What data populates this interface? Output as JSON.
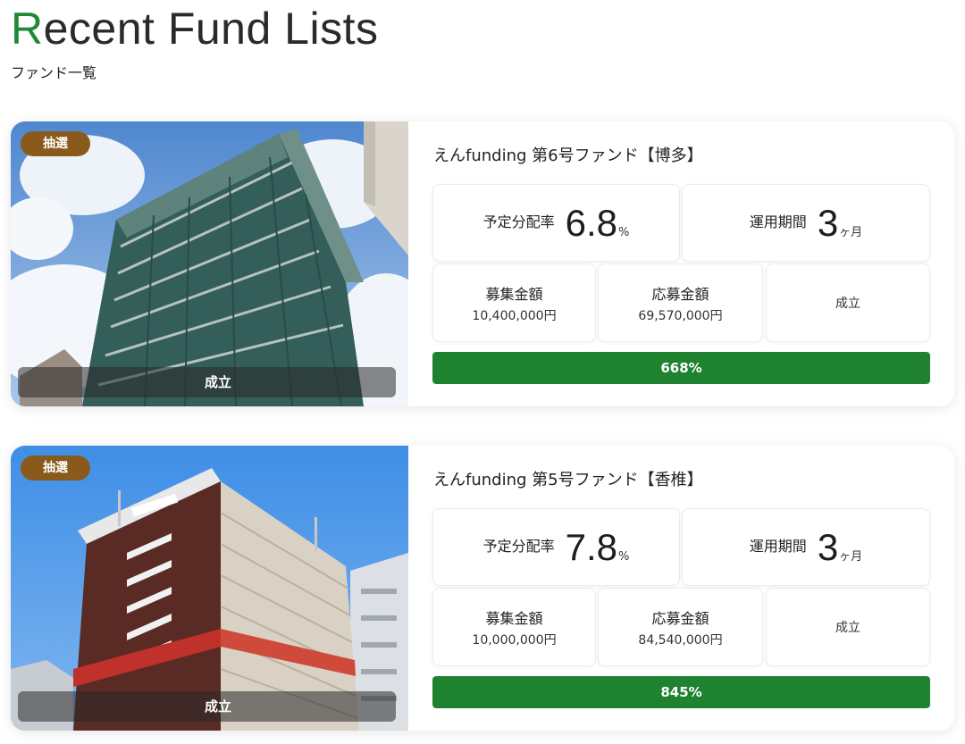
{
  "heading": {
    "title_first_letter": "R",
    "title_rest": "ecent Fund Lists",
    "subtitle": "ファンド一覧"
  },
  "colors": {
    "accent": "#1e8a35",
    "badge": "#8a5a1c",
    "progress": "#1e8231"
  },
  "funds": [
    {
      "badge": "抽選",
      "photo_status": "成立",
      "title": "えんfunding 第6号ファンド【博多】",
      "rate_label": "予定分配率",
      "rate_value": "6.8",
      "rate_unit": "%",
      "term_label": "運用期間",
      "term_value": "3",
      "term_unit": "ヶ月",
      "amount_label": "募集金額",
      "amount_value": "10,400,000円",
      "applied_label": "応募金額",
      "applied_value": "69,570,000円",
      "status": "成立",
      "progress_text": "668%",
      "progress_fraction": 1.0
    },
    {
      "badge": "抽選",
      "photo_status": "成立",
      "title": "えんfunding 第5号ファンド【香椎】",
      "rate_label": "予定分配率",
      "rate_value": "7.8",
      "rate_unit": "%",
      "term_label": "運用期間",
      "term_value": "3",
      "term_unit": "ヶ月",
      "amount_label": "募集金額",
      "amount_value": "10,000,000円",
      "applied_label": "応募金額",
      "applied_value": "84,540,000円",
      "status": "成立",
      "progress_text": "845%",
      "progress_fraction": 1.0
    }
  ]
}
